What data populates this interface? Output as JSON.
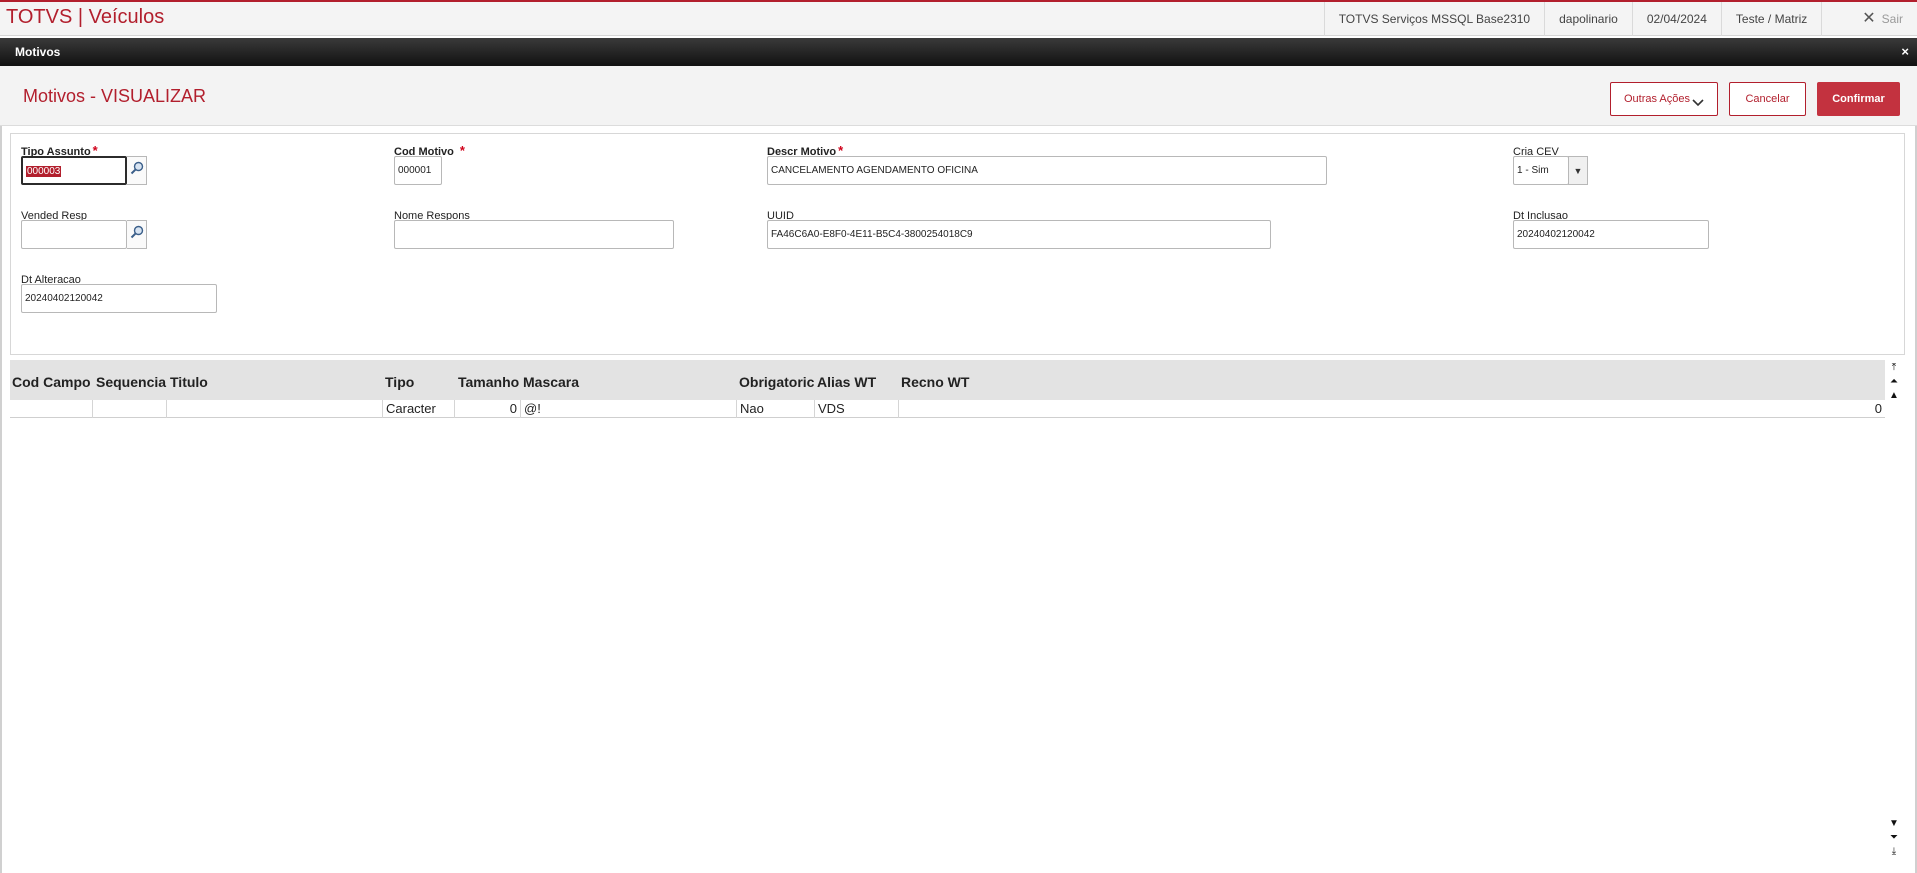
{
  "app": {
    "title": "TOTVS | Veículos"
  },
  "status": {
    "environment": "TOTVS Serviços MSSQL Base2310",
    "user": "dapolinario",
    "date": "02/04/2024",
    "branch": "Teste / Matriz",
    "logout_label": "Sair"
  },
  "dialog": {
    "title": "Motivos",
    "close_glyph": "×"
  },
  "page": {
    "title": "Motivos - VISUALIZAR",
    "buttons": {
      "outras": "Outras Ações",
      "cancel": "Cancelar",
      "confirm": "Confirmar"
    }
  },
  "form": {
    "tipo_assunto": {
      "label": "Tipo Assunto",
      "value": "000003",
      "required": "*"
    },
    "cod_motivo": {
      "label": "Cod Motivo",
      "value": "000001",
      "required": "*"
    },
    "descr_motivo": {
      "label": "Descr Motivo",
      "value": "CANCELAMENTO AGENDAMENTO OFICINA",
      "required": "*"
    },
    "cria_cev": {
      "label": "Cria CEV",
      "value": "1 - Sim"
    },
    "vended_resp": {
      "label": "Vended Resp",
      "value": ""
    },
    "nome_respons": {
      "label": "Nome Respons",
      "value": ""
    },
    "uuid": {
      "label": "UUID",
      "value": "FA46C6A0-E8F0-4E11-B5C4-3800254018C9"
    },
    "dt_inclusao": {
      "label": "Dt Inclusao",
      "value": "20240402120042"
    },
    "dt_alteracao": {
      "label": "Dt Alteracao",
      "value": "20240402120042"
    }
  },
  "grid": {
    "columns": [
      "Cod Campo",
      "Sequencia",
      "Titulo",
      "Tipo",
      "Tamanho",
      "Mascara",
      "Obrigatoric",
      "Alias WT",
      "Recno WT"
    ],
    "rows": [
      [
        "",
        "",
        "",
        "Caracter",
        "0",
        "@!",
        "Nao",
        "VDS",
        "0"
      ]
    ]
  }
}
